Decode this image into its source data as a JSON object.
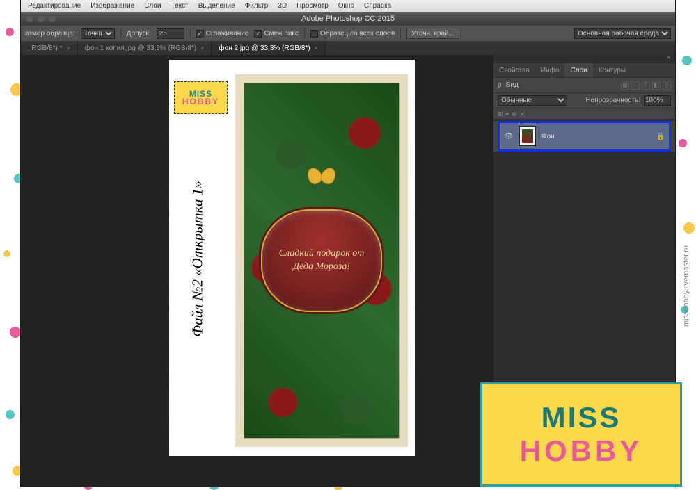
{
  "mac_menu": [
    "Редактирование",
    "Изображение",
    "Слои",
    "Текст",
    "Выделение",
    "Фильтр",
    "3D",
    "Просмотр",
    "Окно",
    "Справка"
  ],
  "title": "Adobe Photoshop CC 2015",
  "options": {
    "sample_label": "азмер образца:",
    "sample_value": "Точка",
    "tolerance_label": "Допуск:",
    "tolerance_value": "25",
    "antialias": "Сглаживание",
    "contiguous": "Смеж.пикс",
    "all_layers": "Образец со всех слоев",
    "refine": "Уточн. край...",
    "workspace": "Основная рабочая среда"
  },
  "tabs": [
    {
      "label": ", RGB/8*) *",
      "active": false
    },
    {
      "label": "фон 1 копия.jpg @ 33,3% (RGB/8*)",
      "active": false
    },
    {
      "label": "фон 2.jpg @ 33,3% (RGB/8*)",
      "active": true
    }
  ],
  "canvas": {
    "sidetext": "Файл №2 «Открытка 1»",
    "badge_l1": "MISS",
    "badge_l2": "HOBBY",
    "plaque": "Сладкий подарок от Деда Мороза!"
  },
  "panels": {
    "tabs": [
      "Свойства",
      "Инфо",
      "Слои",
      "Контуры"
    ],
    "active_tab": 2,
    "filter_label": "Вид",
    "blend_mode": "Обычные",
    "opacity_label": "Непрозрачность:",
    "opacity_value": "100%",
    "layer_name": "Фон"
  },
  "big_badge": {
    "l1": "MISS",
    "l2": "HOBBY"
  },
  "watermark": "misshobby.livemaster.ru"
}
